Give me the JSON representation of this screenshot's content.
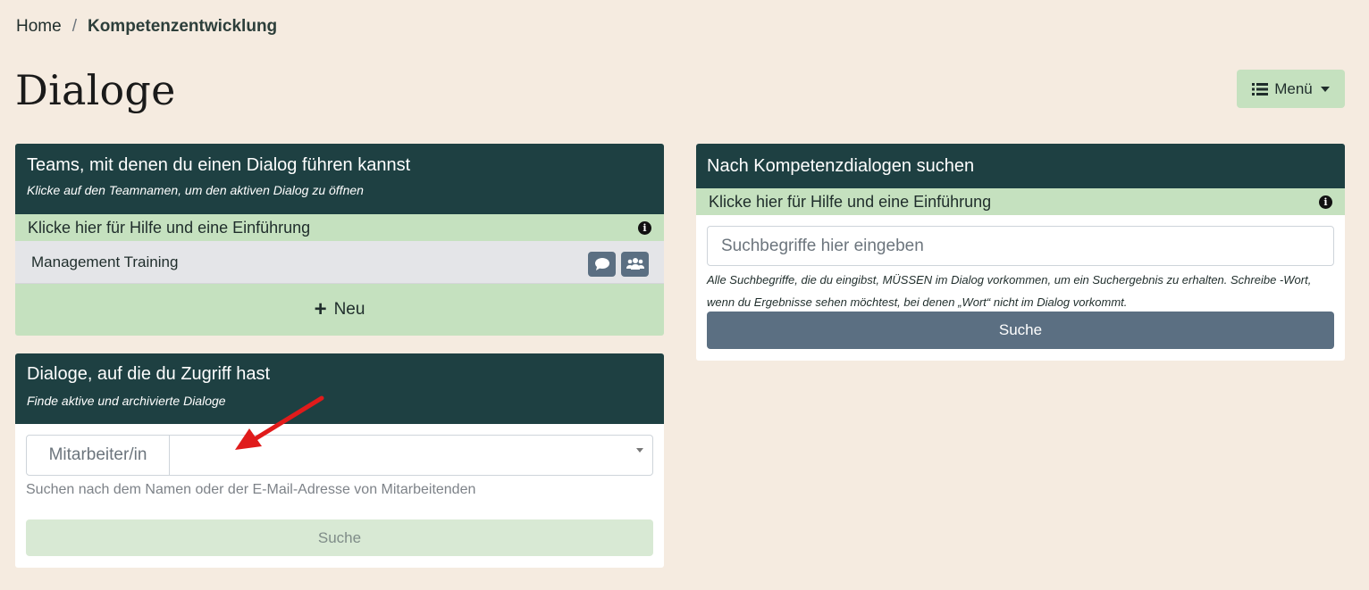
{
  "breadcrumb": {
    "home": "Home",
    "separator": "/",
    "current": "Kompetenzentwicklung"
  },
  "page": {
    "title": "Dialoge"
  },
  "menu": {
    "label": "Menü",
    "icon": "list-icon",
    "caret": "caret-down-icon"
  },
  "teams_card": {
    "title": "Teams, mit denen du einen Dialog führen kannst",
    "subtitle": "Klicke auf den Teamnamen, um den aktiven Dialog zu öffnen",
    "help_label": "Klicke hier für Hilfe und eine Einführung",
    "teams": [
      {
        "name": "Management Training",
        "actions": [
          "chat-icon",
          "team-icon"
        ]
      }
    ],
    "new_label": "Neu"
  },
  "access_card": {
    "title": "Dialoge, auf die du Zugriff hast",
    "subtitle": "Finde aktive und archivierte Dialoge",
    "employee_label": "Mitarbeiter/in",
    "employee_value": "",
    "help_text": "Suchen nach dem Namen oder der E-Mail-Adresse von Mitarbeitenden",
    "search_label": "Suche"
  },
  "search_card": {
    "title": "Nach Kompetenzdialogen suchen",
    "help_label": "Klicke hier für Hilfe und eine Einführung",
    "placeholder": "Suchbegriffe hier eingeben",
    "note": "Alle Suchbegriffe, die du eingibst, MÜSSEN im Dialog vorkommen, um ein Suchergebnis zu erhalten. Schreibe -Wort, wenn du Ergebnisse sehen möchtest, bei denen „Wort“ nicht im Dialog vorkommt.",
    "search_label": "Suche"
  },
  "colors": {
    "background": "#f5ebe0",
    "header": "#1e4042",
    "accent_green": "#c5e1bf",
    "button_slate": "#5b6f82",
    "arrow": "#e01b1b"
  }
}
